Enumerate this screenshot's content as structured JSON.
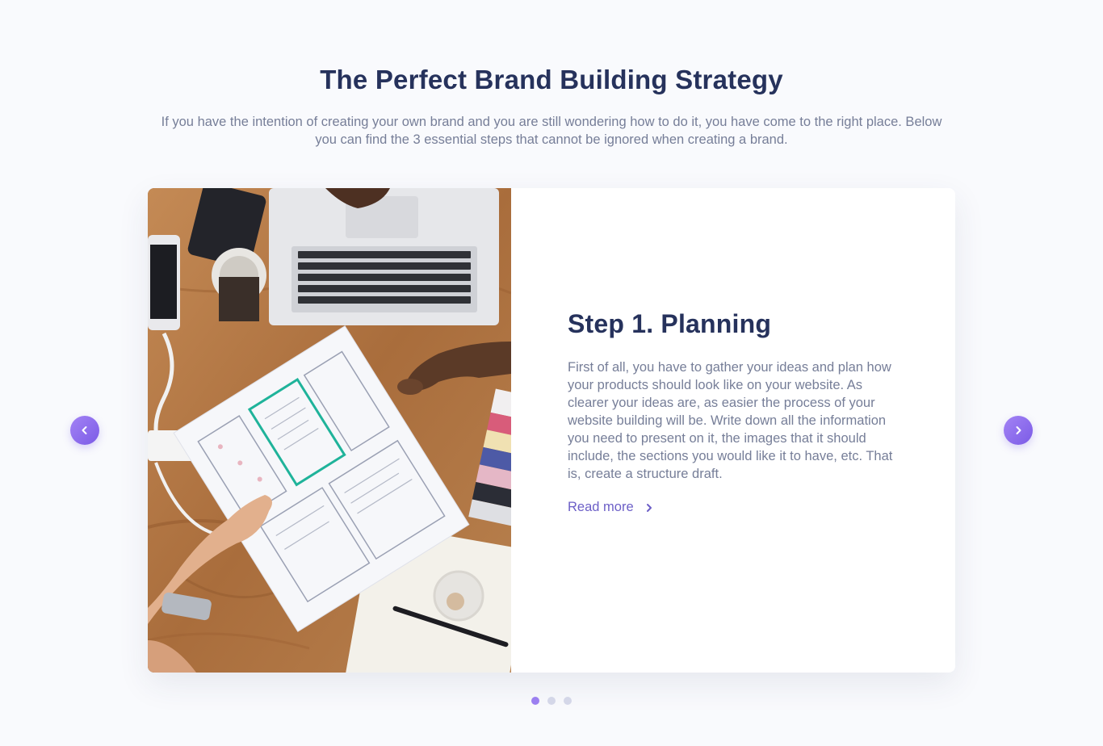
{
  "section": {
    "title": "The Perfect Brand Building Strategy",
    "intro": "If you have the intention of creating your own brand and you are still wondering how to do it, you have come to the right place. Below you can find the 3 essential steps that cannot be ignored when creating a brand."
  },
  "slider": {
    "active_index": 0,
    "slide_count": 3,
    "prev_icon": "chevron-left-icon",
    "next_icon": "chevron-right-icon",
    "current": {
      "image": "hands-passing-wireframe-sketch-photo",
      "title": "Step 1. Planning",
      "text": "First of all, you have to gather your ideas and plan how your products should look like on your website. As clearer your ideas are, as easier the process of your website building will be. Write down all the information you need to present on it, the images that it should include, the sections you would like it to have, etc. That is, create a structure draft.",
      "read_more": "Read more",
      "read_more_icon": "chevron-right-icon"
    }
  },
  "colors": {
    "heading": "#26325c",
    "body_text": "#767e98",
    "accent": "#6c5fc7",
    "button_gradient_start": "#a383f5",
    "button_gradient_end": "#7b5be6",
    "dot_active": "#9b7ff0",
    "dot_inactive": "#d4d7e8",
    "background": "#f9fafd"
  }
}
